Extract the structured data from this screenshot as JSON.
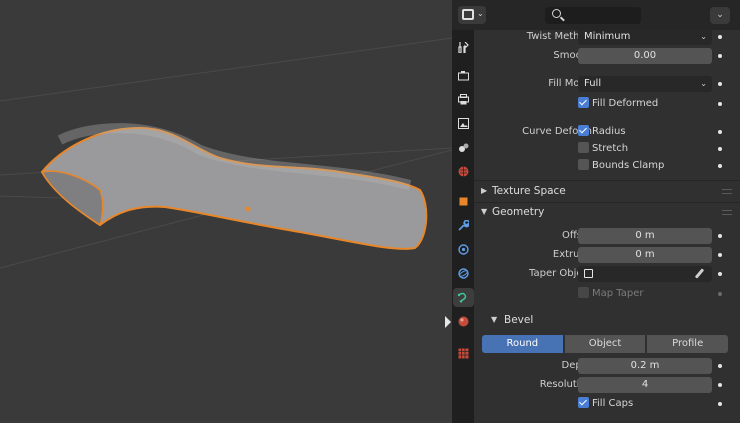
{
  "colors": {
    "accent": "#4772b3",
    "selection_outline": "#e8872a",
    "viewport_bg": "#3a3a3a",
    "panel_bg": "#303030"
  },
  "header": {
    "editor_type_icon": "properties-editor-icon",
    "search_icon": "search-icon",
    "menu_icon": "chevron-down-icon"
  },
  "tabs": [
    {
      "name": "tool",
      "icon": "tool-icon"
    },
    {
      "name": "render",
      "icon": "render-camera-icon"
    },
    {
      "name": "output",
      "icon": "printer-icon"
    },
    {
      "name": "view-layer",
      "icon": "image-icon"
    },
    {
      "name": "scene",
      "icon": "scene-icon"
    },
    {
      "name": "world",
      "icon": "world-icon"
    },
    {
      "name": "object",
      "icon": "object-icon"
    },
    {
      "name": "modifiers",
      "icon": "wrench-icon"
    },
    {
      "name": "particles",
      "icon": "particles-icon"
    },
    {
      "name": "physics",
      "icon": "physics-icon"
    },
    {
      "name": "object-data",
      "icon": "curve-data-icon",
      "active": true
    },
    {
      "name": "material",
      "icon": "material-icon"
    },
    {
      "name": "texture",
      "icon": "texture-icon"
    }
  ],
  "props": {
    "twist_method": {
      "label": "Twist Method",
      "value": "Minimum"
    },
    "smooth": {
      "label": "Smooth",
      "value": "0.00"
    },
    "fill_mode": {
      "label": "Fill Mode",
      "value": "Full"
    },
    "fill_deformed": {
      "label": "Fill Deformed",
      "checked": true
    },
    "curve_deform": {
      "label": "Curve Deform"
    },
    "radius": {
      "label": "Radius",
      "checked": true
    },
    "stretch": {
      "label": "Stretch",
      "checked": false
    },
    "bounds_clamp": {
      "label": "Bounds Clamp",
      "checked": false
    },
    "texture_space": {
      "title": "Texture Space",
      "expanded": false
    },
    "geometry": {
      "title": "Geometry",
      "expanded": true
    },
    "offset": {
      "label": "Offset",
      "value": "0 m"
    },
    "extrude": {
      "label": "Extrude",
      "value": "0 m"
    },
    "taper_object": {
      "label": "Taper Object",
      "value": ""
    },
    "map_taper": {
      "label": "Map Taper",
      "checked": false,
      "disabled": true
    },
    "bevel": {
      "title": "Bevel",
      "expanded": true
    },
    "bevel_modes": [
      "Round",
      "Object",
      "Profile"
    ],
    "bevel_mode_selected": "Round",
    "depth": {
      "label": "Depth",
      "value": "0.2 m"
    },
    "resolution": {
      "label": "Resolution",
      "value": "4"
    },
    "fill_caps": {
      "label": "Fill Caps",
      "checked": true
    }
  }
}
